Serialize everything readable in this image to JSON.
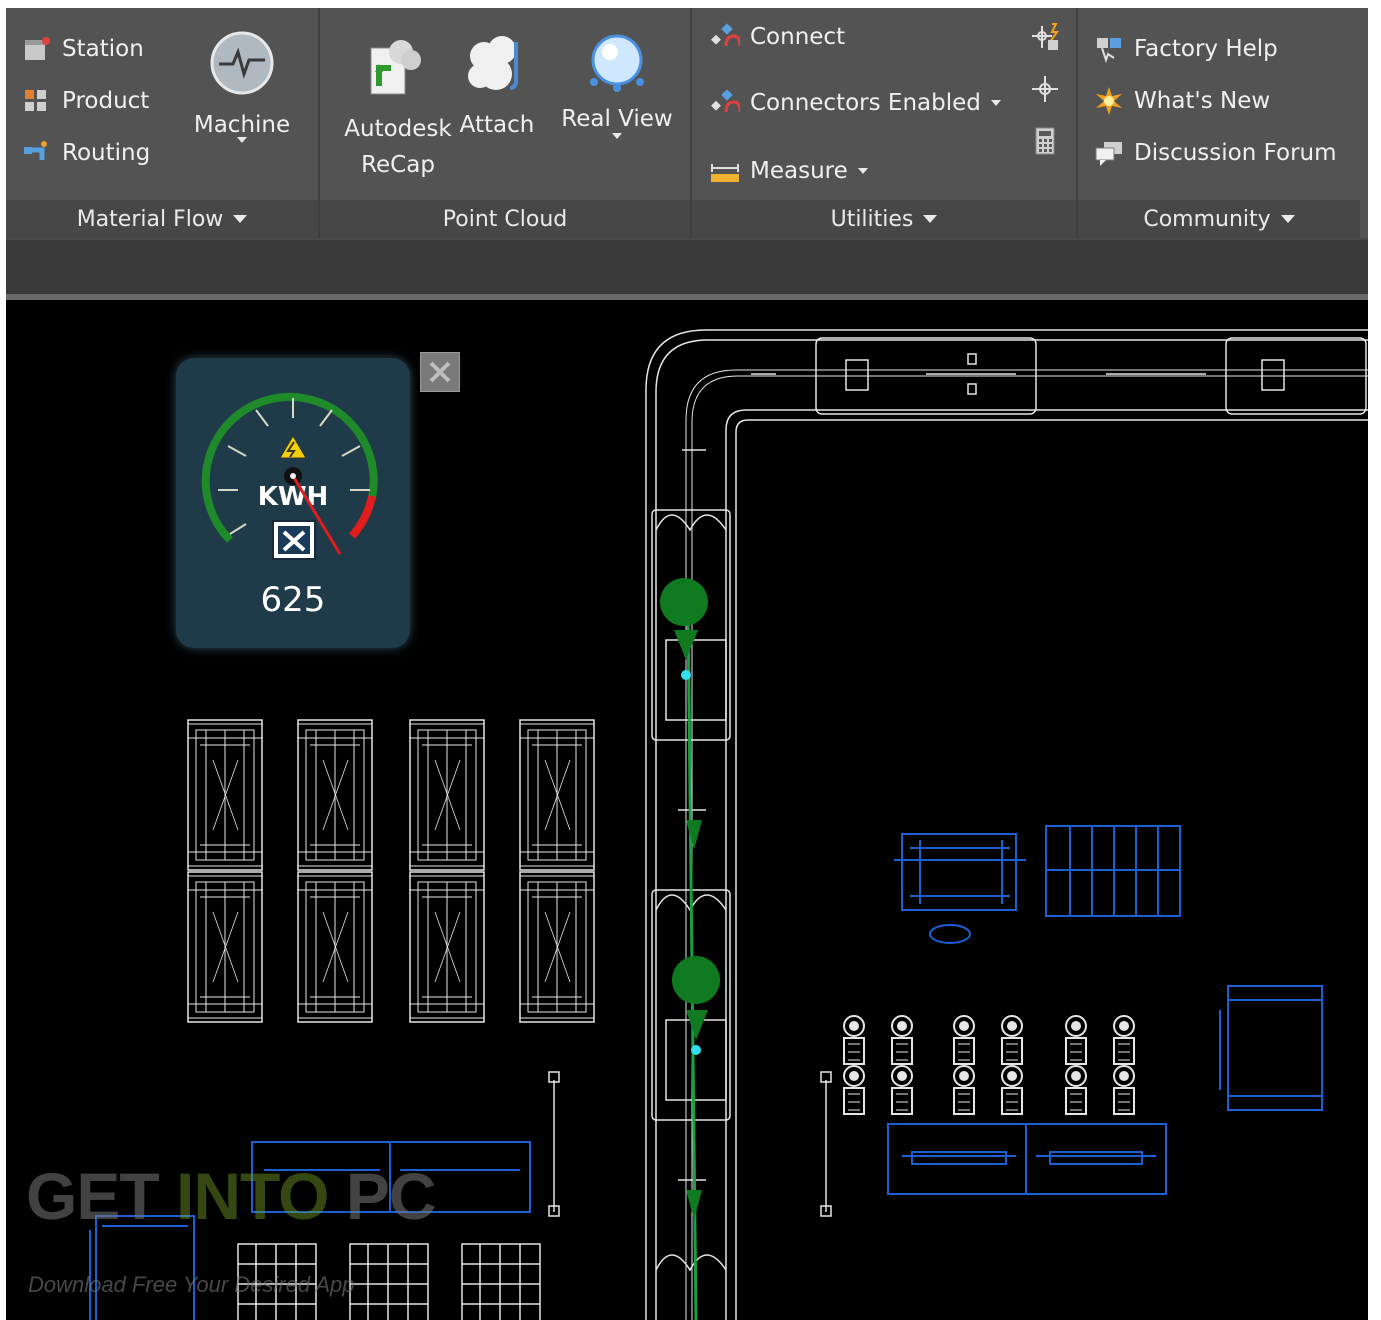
{
  "ribbon": {
    "material_flow": {
      "title": "Material Flow",
      "items": [
        {
          "label": "Station",
          "icon": "station-icon"
        },
        {
          "label": "Product",
          "icon": "product-icon"
        },
        {
          "label": "Routing",
          "icon": "routing-icon"
        }
      ],
      "machine_label": "Machine"
    },
    "point_cloud": {
      "title": "Point Cloud",
      "recap_label_1": "Autodesk",
      "recap_label_2": "ReCap",
      "attach_label": "Attach",
      "real_view_label": "Real View"
    },
    "utilities": {
      "title": "Utilities",
      "connect_label": "Connect",
      "connectors_enabled_label": "Connectors Enabled",
      "measure_label": "Measure"
    },
    "community": {
      "title": "Community",
      "factory_help_label": "Factory Help",
      "whats_new_label": "What's New",
      "discussion_forum_label": "Discussion Forum"
    }
  },
  "gauge": {
    "unit": "KWH",
    "value": "625"
  },
  "watermark": {
    "part1": "GET ",
    "part2": "INTO",
    "part3": " PC",
    "sub": "Download Free Your Desired App"
  },
  "colors": {
    "ribbon_bg": "#535353",
    "canvas_bg": "#000000",
    "cad_white": "#e6e6e6",
    "cad_blue": "#1a5fd6",
    "flow_green": "#0f7a1f",
    "gauge_bg": "#1f3a48"
  }
}
